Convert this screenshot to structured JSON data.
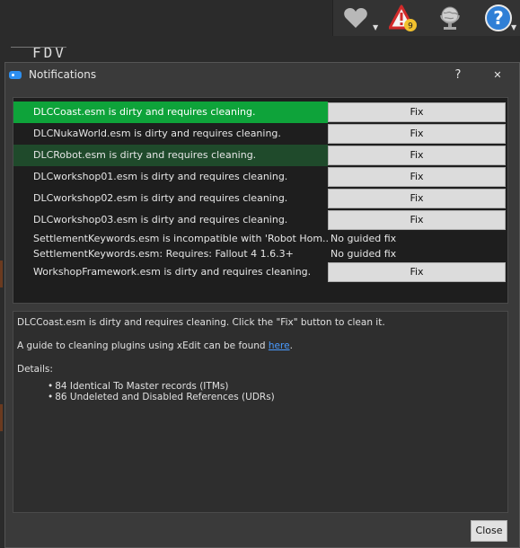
{
  "background": {
    "toolbar": {
      "endorse_icon": "heart-icon",
      "notifications_icon": "warning-triangle-icon",
      "notification_count": "9",
      "update_icon": "globe-icon",
      "help_icon": "help-circle-icon"
    },
    "cropped_label": "FDV"
  },
  "dialog": {
    "title": "Notifications",
    "help_label": "?",
    "close_x_label": "✕",
    "rows": [
      {
        "message": "DLCCoast.esm is dirty and requires cleaning.",
        "action": "Fix"
      },
      {
        "message": "DLCNukaWorld.esm is dirty and requires cleaning.",
        "action": "Fix"
      },
      {
        "message": "DLCRobot.esm is dirty and requires cleaning.",
        "action": "Fix"
      },
      {
        "message": "DLCworkshop01.esm is dirty and requires cleaning.",
        "action": "Fix"
      },
      {
        "message": "DLCworkshop02.esm is dirty and requires cleaning.",
        "action": "Fix"
      },
      {
        "message": "DLCworkshop03.esm is dirty and requires cleaning.",
        "action": "Fix"
      },
      {
        "message": "SettlementKeywords.esm is incompatible with 'Robot Hom...",
        "action": "No guided fix"
      },
      {
        "message": "SettlementKeywords.esm: Requires: Fallout 4 1.6.3+",
        "action": "No guided fix"
      },
      {
        "message": "WorkshopFramework.esm is dirty and requires cleaning.",
        "action": "Fix"
      }
    ],
    "details": {
      "summary": "DLCCoast.esm is dirty and requires cleaning. Click the \"Fix\" button to clean it.",
      "guide_prefix": "A guide to cleaning plugins using xEdit can be found ",
      "guide_link": "here",
      "guide_suffix": ".",
      "details_label": "Details:",
      "items": [
        "84 Identical To Master records (ITMs)",
        "86 Undeleted and Disabled References (UDRs)"
      ]
    },
    "close_label": "Close"
  },
  "colors": {
    "selected_row": "#0ea33a",
    "highlight_row": "#1f4a2b",
    "link": "#4a9bff",
    "badge": "#f2c12e"
  }
}
